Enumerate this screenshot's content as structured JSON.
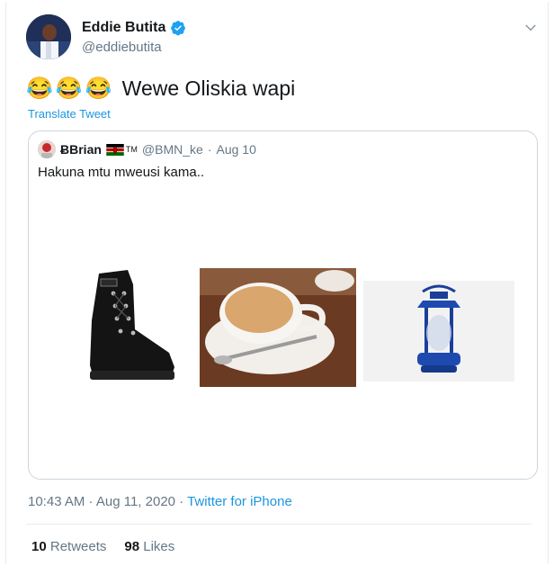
{
  "author": {
    "name": "Eddie Butita",
    "handle": "@eddiebutita"
  },
  "tweet": {
    "emojis": [
      "😂",
      "😂",
      "😂"
    ],
    "text": "Wewe Oliskia wapi",
    "translate_label": "Translate Tweet"
  },
  "quote": {
    "name": "Brian",
    "name_glyph": "Ƀ",
    "tm": "TM",
    "handle": "@BMN_ke",
    "dot": "·",
    "date": "Aug 10",
    "text": "Hakuna mtu mweusi kama.."
  },
  "meta": {
    "time": "10:43 AM · Aug 11, 2020 · ",
    "source": "Twitter for iPhone"
  },
  "stats": {
    "retweets_count": "10",
    "retweets_label": "Retweets",
    "likes_count": "98",
    "likes_label": "Likes"
  },
  "colors": {
    "link": "#1b95e0",
    "muted": "#657786",
    "verified": "#1da1f2"
  }
}
